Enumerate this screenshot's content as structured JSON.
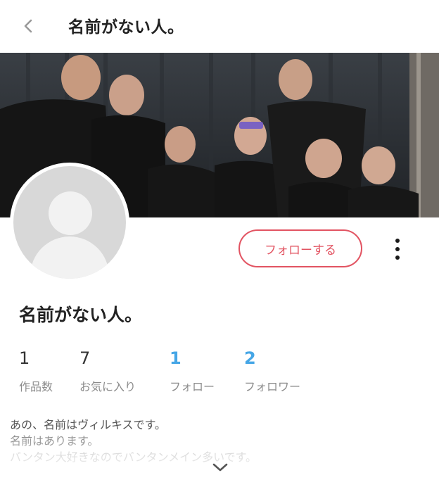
{
  "header": {
    "title": "名前がない人。",
    "back_icon": "chevron-left-icon"
  },
  "banner": {
    "icon": "group-photo"
  },
  "profile": {
    "name": "名前がない人。",
    "follow_label": "フォローする",
    "more_icon": "vertical-dots-icon"
  },
  "stats": [
    {
      "value": "1",
      "label": "作品数"
    },
    {
      "value": "7",
      "label": "お気に入り"
    },
    {
      "value": "1",
      "label": "フォロー"
    },
    {
      "value": "2",
      "label": "フォロワー"
    }
  ],
  "bio": {
    "lines": [
      "あの、名前はヴィルキスです。",
      "名前はあります。",
      "バンタン大好きなのでバンタンメイン多いです。"
    ],
    "expand_icon": "chevron-down-icon"
  },
  "colors": {
    "accent": "#e25462",
    "link": "#45a6e6",
    "avatar_bg": "#d8d8d8"
  }
}
